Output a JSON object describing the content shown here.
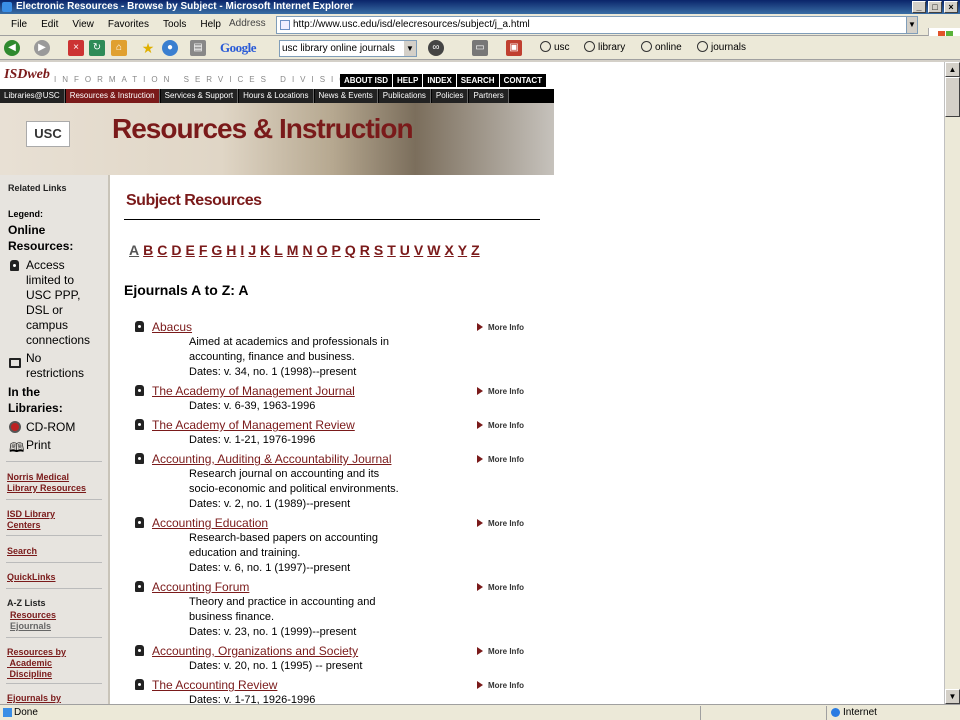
{
  "window": {
    "title": "Electronic Resources - Browse by Subject - Microsoft Internet Explorer"
  },
  "menu": [
    "File",
    "Edit",
    "View",
    "Favorites",
    "Tools",
    "Help"
  ],
  "address": {
    "label": "Address",
    "url": "http://www.usc.edu/isd/elecresources/subject/j_a.html"
  },
  "google": {
    "brand": "Google",
    "query": "usc library online journals",
    "buttons": [
      "usc",
      "library",
      "online",
      "journals"
    ]
  },
  "status": {
    "left": "Done",
    "right": "Internet"
  },
  "header": {
    "logo": "ISDweb",
    "tagline": "INFORMATION SERVICES DIVISION",
    "top_links": [
      "ABOUT ISD",
      "HELP",
      "INDEX",
      "SEARCH",
      "CONTACT"
    ],
    "nav": [
      "Libraries@USC",
      "Resources & Instruction",
      "Services & Support",
      "Hours & Locations",
      "News & Events",
      "Publications",
      "Policies",
      "Partners"
    ],
    "nav_active": "Resources & Instruction",
    "usc": "USC",
    "section_title": "Resources & Instruction"
  },
  "sidebar": {
    "related": "Related Links",
    "legend": "Legend:",
    "online": [
      "Online",
      "Resources:"
    ],
    "restricted": [
      "Access",
      "limited to",
      "USC PPP,",
      "DSL or",
      "campus",
      "connections"
    ],
    "norestrict": [
      "No",
      "restrictions"
    ],
    "inlib": [
      "In the",
      "Libraries:"
    ],
    "cdrom": "CD-ROM",
    "print": "Print",
    "links": [
      {
        "l1": "Norris Medical",
        "l2": "Library Resources"
      },
      {
        "l1": "ISD Library",
        "l2": "Centers"
      },
      {
        "l1": "Search",
        "l2": ""
      },
      {
        "l1": "QuickLinks",
        "l2": ""
      }
    ],
    "az_title": "A-Z Lists",
    "az": [
      "Resources",
      "Ejournals"
    ],
    "discipline": [
      "Resources by",
      "Academic",
      "Discipline"
    ],
    "ejby": "Ejournals by"
  },
  "page": {
    "subject_title": "Subject Resources",
    "letters": [
      "A",
      "B",
      "C",
      "D",
      "E",
      "F",
      "G",
      "H",
      "I",
      "J",
      "K",
      "L",
      "M",
      "N",
      "O",
      "P",
      "Q",
      "R",
      "S",
      "T",
      "U",
      "V",
      "W",
      "X",
      "Y",
      "Z"
    ],
    "heading": "Ejournals A to Z: A",
    "more_info": "More Info",
    "entries": [
      {
        "title": "Abacus",
        "lines": [
          "Aimed at academics and professionals in",
          "accounting, finance and business.",
          "Dates: v. 34, no. 1 (1998)--present"
        ]
      },
      {
        "title": "The Academy of Management Journal",
        "lines": [
          "Dates: v. 6-39, 1963-1996"
        ]
      },
      {
        "title": "The Academy of Management Review",
        "lines": [
          "Dates: v. 1-21, 1976-1996"
        ]
      },
      {
        "title": "Accounting, Auditing & Accountability Journal",
        "lines": [
          "Research journal on accounting and its",
          "socio-economic and political environments.",
          "Dates: v. 2, no. 1 (1989)--present"
        ]
      },
      {
        "title": "Accounting Education",
        "lines": [
          "Research-based papers on accounting",
          "education and training.",
          "Dates: v. 6, no. 1 (1997)--present"
        ]
      },
      {
        "title": "Accounting Forum",
        "lines": [
          "Theory and practice in accounting and",
          "business finance.",
          "Dates: v. 23, no. 1 (1999)--present"
        ]
      },
      {
        "title": "Accounting, Organizations and Society",
        "lines": [
          "Dates: v. 20, no. 1 (1995) -- present"
        ]
      },
      {
        "title": "The Accounting Review",
        "lines": [
          "Dates: v. 1-71, 1926-1996"
        ]
      }
    ]
  }
}
